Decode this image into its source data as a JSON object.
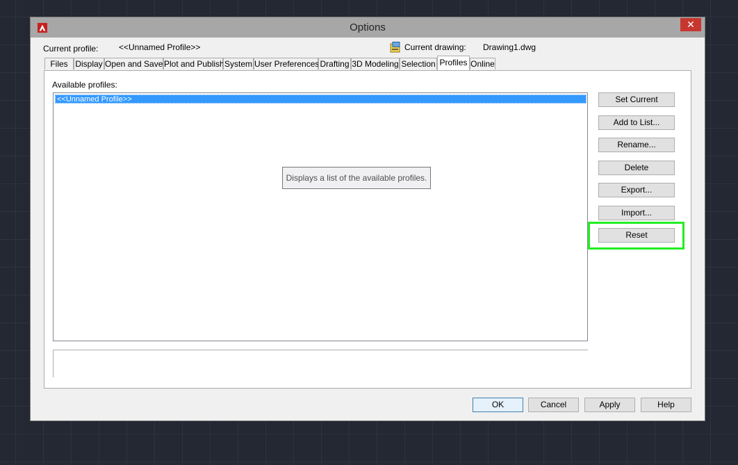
{
  "window": {
    "title": "Options",
    "close_glyph": "✕"
  },
  "header": {
    "current_profile_label": "Current profile:",
    "current_profile_value": "<<Unnamed Profile>>",
    "current_drawing_label": "Current drawing:",
    "current_drawing_value": "Drawing1.dwg"
  },
  "tabs": [
    "Files",
    "Display",
    "Open and Save",
    "Plot and Publish",
    "System",
    "User Preferences",
    "Drafting",
    "3D Modeling",
    "Selection",
    "Profiles",
    "Online"
  ],
  "active_tab": "Profiles",
  "profiles": {
    "available_label": "Available profiles:",
    "items": [
      "<<Unnamed Profile>>"
    ],
    "selected_index": 0,
    "tooltip": "Displays a list of the available profiles.",
    "buttons": {
      "set_current": "Set Current",
      "add_to_list": "Add to List...",
      "rename": "Rename...",
      "delete": "Delete",
      "export": "Export...",
      "import": "Import...",
      "reset": "Reset"
    },
    "highlighted_button": "reset"
  },
  "footer": {
    "ok": "OK",
    "cancel": "Cancel",
    "apply": "Apply",
    "help": "Help"
  },
  "colors": {
    "selection": "#3399ff",
    "highlight_outline": "#22ee22",
    "close_button": "#c7372f",
    "app_icon": "#c81e1e"
  }
}
